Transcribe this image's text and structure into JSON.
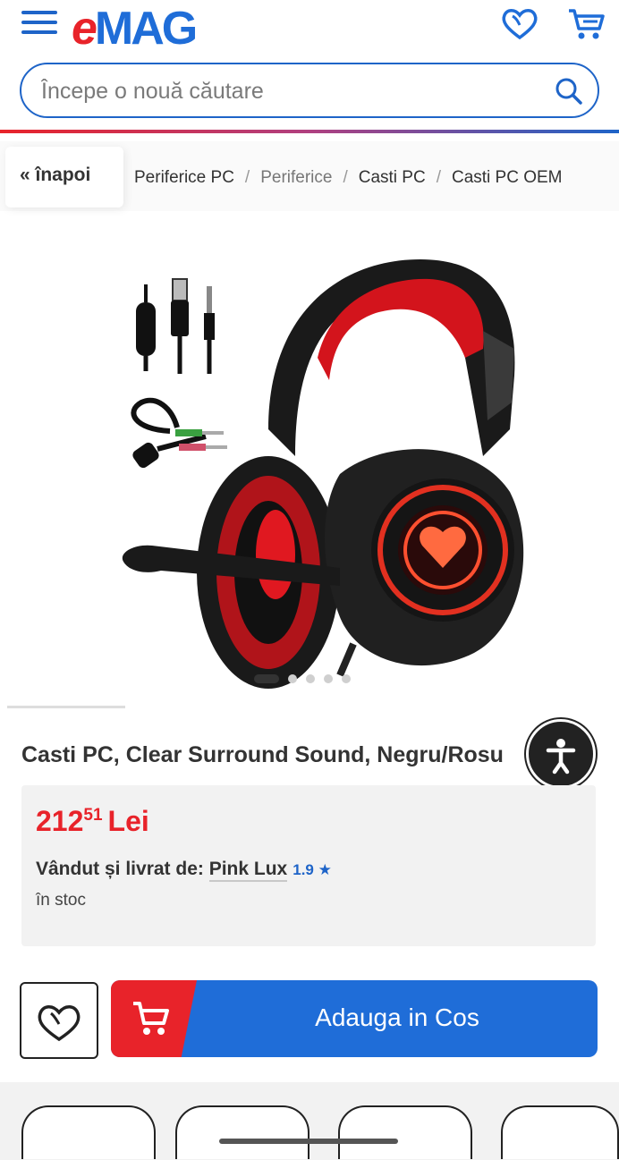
{
  "header": {
    "logo_e": "e",
    "logo_mag": "MAG",
    "icons": [
      "menu-icon",
      "heart-icon",
      "cart-icon",
      "search-icon"
    ],
    "colors": {
      "brand_blue": "#1f6dd8",
      "brand_red": "#e8232a"
    }
  },
  "search": {
    "placeholder": "Începe o nouă căutare"
  },
  "breadcrumb": {
    "back_label": "« înapoi",
    "items": [
      "Periferice PC",
      "Periferice",
      "Casti PC",
      "Casti PC OEM"
    ]
  },
  "gallery": {
    "image_alt": "Casti PC headset negru cu rosu",
    "dots_total": 5,
    "active_dot": 1
  },
  "product": {
    "title": "Casti PC, Clear Surround Sound, Negru/Rosu",
    "price_int": "212",
    "price_dec": "51",
    "currency": "Lei",
    "seller_label": "Vândut și livrat de:",
    "seller_name": "Pink Lux",
    "seller_rating": "1.9",
    "stock": "în stoc"
  },
  "actions": {
    "add_to_cart_label": "Adauga in Cos"
  }
}
